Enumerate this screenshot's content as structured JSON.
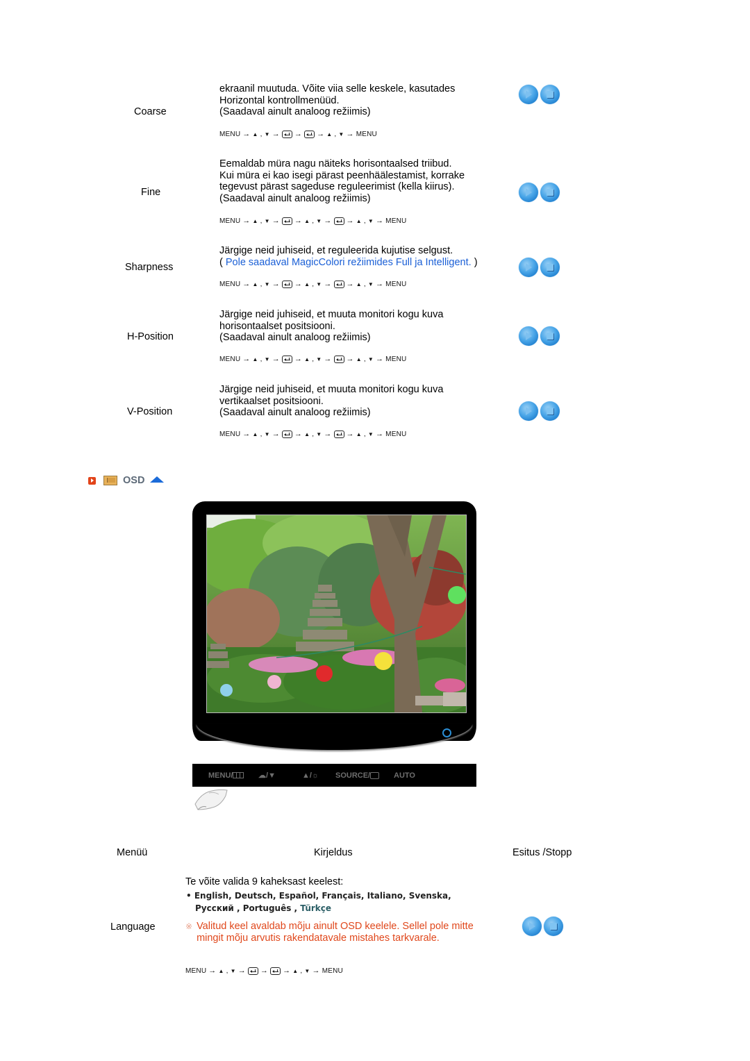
{
  "rows": [
    {
      "label": "Coarse",
      "desc_lines": [
        "ekraanil muutuda. Võite viia selle keskele, kasutades",
        "Horizontal kontrollmenüüd.",
        "(Saadaval ainult analoog režiimis)"
      ],
      "path": [
        "MENU",
        "→",
        "▲",
        ",",
        "▼",
        "→",
        "enter-icon",
        "→",
        "enter-icon",
        "→",
        "▲",
        ",",
        "▼",
        "→",
        "MENU"
      ]
    },
    {
      "label": "Fine",
      "desc_lines": [
        "Eemaldab müra nagu näiteks horisontaalsed triibud.",
        "Kui müra ei kao isegi pärast peenhäälestamist, korrake",
        "tegevust pärast sageduse reguleerimist (kella kiirus).",
        "(Saadaval ainult analoog režiimis)"
      ],
      "path": [
        "MENU",
        "→",
        "▲",
        ",",
        "▼",
        "→",
        "enter-icon",
        "→",
        "▲",
        ",",
        "▼",
        "→",
        "enter-icon",
        "→",
        "▲",
        ",",
        "▼",
        "→",
        "MENU"
      ]
    },
    {
      "label": "Sharpness",
      "desc_lines": [
        "Järgige neid juhiseid, et reguleerida kujutise selgust."
      ],
      "note_prefix": "( ",
      "note_blue": "Pole saadaval MagicColori režiimides Full ja Intelligent.",
      "note_suffix": " )",
      "path": [
        "MENU",
        "→",
        "▲",
        ",",
        "▼",
        "→",
        "enter-icon",
        "→",
        "▲",
        ",",
        "▼",
        "→",
        "enter-icon",
        "→",
        "▲",
        ",",
        "▼",
        "→",
        "MENU"
      ]
    },
    {
      "label": "H-Position",
      "desc_lines": [
        "Järgige neid juhiseid, et muuta monitori kogu kuva",
        "horisontaalset positsiooni.",
        "(Saadaval ainult analoog režiimis)"
      ],
      "path": [
        "MENU",
        "→",
        "▲",
        ",",
        "▼",
        "→",
        "enter-icon",
        "→",
        "▲",
        ",",
        "▼",
        "→",
        "enter-icon",
        "→",
        "▲",
        ",",
        "▼",
        "→",
        "MENU"
      ]
    },
    {
      "label": "V-Position",
      "desc_lines": [
        "Järgige neid juhiseid, et muuta monitori kogu kuva",
        "vertikaalset positsiooni.",
        "(Saadaval ainult analoog režiimis)"
      ],
      "path": [
        "MENU",
        "→",
        "▲",
        ",",
        "▼",
        "→",
        "enter-icon",
        "→",
        "▲",
        ",",
        "▼",
        "→",
        "enter-icon",
        "→",
        "▲",
        ",",
        "▼",
        "→",
        "MENU"
      ]
    }
  ],
  "osd": {
    "title": "OSD",
    "control_bar": {
      "menu": "MENU/",
      "magicbright": "/",
      "brightness": "/",
      "source": "SOURCE/",
      "auto": "AUTO"
    }
  },
  "table_header": {
    "menu": "Menüü",
    "description": "Kirjeldus",
    "play_stop": "Esitus /Stopp"
  },
  "language": {
    "label": "Language",
    "intro": "Te võite valida 9 kaheksast keelest:",
    "bullet": "•",
    "languages_line1": "English, Deutsch, Español, Français,  Italiano, Svenska,",
    "languages_line2a": "Русский , Português , ",
    "languages_line2b": "Türkçe",
    "note_mark": "※",
    "note_lines": [
      "Valitud keel avaldab mõju ainult OSD keelele. Sellel pole mitte",
      "mingit mõju arvutis rakendatavale mistahes tarkvarale."
    ],
    "path": [
      "MENU",
      "→",
      "▲",
      ",",
      "▼",
      "→",
      "enter-icon",
      "→",
      "enter-icon",
      "→",
      "▲",
      ",",
      "▼",
      "→",
      "MENU"
    ]
  },
  "colors": {
    "note_blue": "#1a5fd6",
    "note_orange": "#e0471b",
    "orb_blue": "#2f8fdd"
  }
}
